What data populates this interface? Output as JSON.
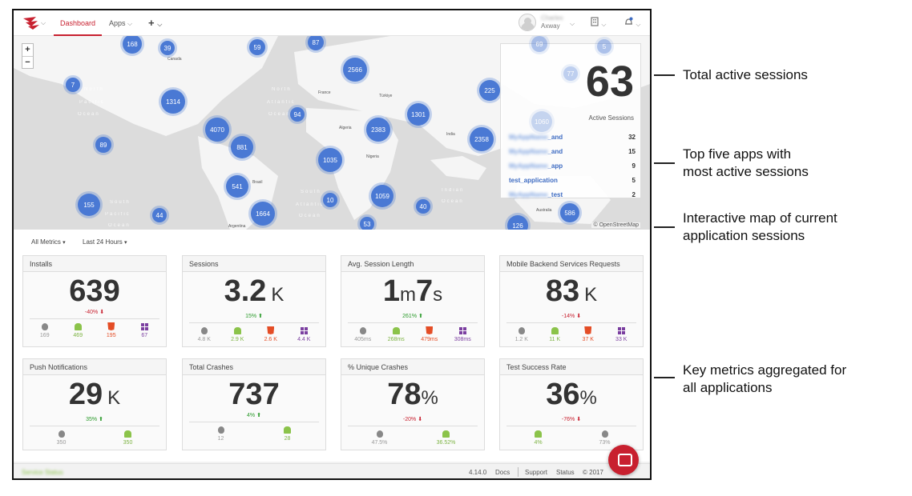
{
  "nav": {
    "dashboard": "Dashboard",
    "apps": "Apps",
    "add": "+",
    "user_name": "Charles",
    "user_org": "Axway"
  },
  "map": {
    "zoom_in": "+",
    "zoom_out": "−",
    "attribution": "© OpenStreetMap",
    "clusters": [
      "168",
      "39",
      "59",
      "87",
      "2566",
      "7",
      "1314",
      "94",
      "1301",
      "225",
      "4070",
      "2383",
      "881",
      "89",
      "2358",
      "1035",
      "541",
      "10",
      "1059",
      "40",
      "155",
      "44",
      "1664",
      "53",
      "126",
      "586",
      "69",
      "5",
      "77",
      "1060"
    ],
    "labels": [
      "North",
      "Pacific",
      "Ocean",
      "North",
      "Atlantic",
      "Ocean",
      "South",
      "Pacific",
      "Ocean",
      "South",
      "Atlantic",
      "Ocean",
      "Indian",
      "Ocean"
    ],
    "cities": [
      "Canada",
      "Brasil",
      "Argentina",
      "Nigeria",
      "Algeria",
      "Australia",
      "India",
      "France",
      "Türkiye"
    ]
  },
  "sessions": {
    "total": "63",
    "label": "Active Sessions",
    "apps": [
      {
        "prefix": "MyAppName",
        "name": "_and",
        "count": "32"
      },
      {
        "prefix": "MyAppName",
        "name": "_and",
        "count": "15"
      },
      {
        "prefix": "MyAppName",
        "name": "_app",
        "count": "9"
      },
      {
        "prefix": "",
        "name": "test_application",
        "count": "5"
      },
      {
        "prefix": "MyAppName",
        "name": "_test",
        "count": "2"
      }
    ]
  },
  "filters": {
    "metrics": "All Metrics",
    "period": "Last 24 Hours"
  },
  "cards": [
    {
      "title": "Installs",
      "value": "639",
      "unit": "",
      "delta": "-40%",
      "dir": "down",
      "plats": [
        {
          "p": "apple",
          "v": "169"
        },
        {
          "p": "android",
          "v": "469"
        },
        {
          "p": "html5",
          "v": "195"
        },
        {
          "p": "windows",
          "v": "67"
        }
      ]
    },
    {
      "title": "Sessions",
      "value": "3.2",
      "unit": "K",
      "delta": "15%",
      "dir": "up",
      "plats": [
        {
          "p": "apple",
          "v": "4.8 K"
        },
        {
          "p": "android",
          "v": "2.9 K"
        },
        {
          "p": "html5",
          "v": "2.6 K"
        },
        {
          "p": "windows",
          "v": "4.4 K"
        }
      ]
    },
    {
      "title": "Avg. Session Length",
      "value": "1",
      "unit": "m",
      "value2": "7",
      "unit2": "s",
      "delta": "261%",
      "dir": "up",
      "plats": [
        {
          "p": "apple",
          "v": "405ms"
        },
        {
          "p": "android",
          "v": "268ms"
        },
        {
          "p": "html5",
          "v": "479ms"
        },
        {
          "p": "windows",
          "v": "308ms"
        }
      ]
    },
    {
      "title": "Mobile Backend Services Requests",
      "value": "83",
      "unit": "K",
      "delta": "-14%",
      "dir": "down",
      "plats": [
        {
          "p": "apple",
          "v": "1.2 K"
        },
        {
          "p": "android",
          "v": "11 K"
        },
        {
          "p": "html5",
          "v": "37 K"
        },
        {
          "p": "windows",
          "v": "33 K"
        }
      ]
    },
    {
      "title": "Push Notifications",
      "value": "29",
      "unit": "K",
      "delta": "35%",
      "dir": "up",
      "plats": [
        {
          "p": "apple",
          "v": "350"
        },
        {
          "p": "android",
          "v": "350"
        }
      ]
    },
    {
      "title": "Total Crashes",
      "value": "737",
      "unit": "",
      "delta": "4%",
      "dir": "up",
      "plats": [
        {
          "p": "apple",
          "v": "12"
        },
        {
          "p": "android",
          "v": "28"
        }
      ]
    },
    {
      "title": "% Unique Crashes",
      "value": "78",
      "unit": "%",
      "delta": "-20%",
      "dir": "down",
      "plats": [
        {
          "p": "apple",
          "v": "47.5%"
        },
        {
          "p": "android",
          "v": "36.52%"
        }
      ]
    },
    {
      "title": "Test Success Rate",
      "value": "36",
      "unit": "%",
      "delta": "-76%",
      "dir": "down",
      "plats": [
        {
          "p": "android",
          "v": "4%"
        },
        {
          "p": "apple",
          "v": "73%"
        }
      ]
    }
  ],
  "footer": {
    "status": "Service Status",
    "version": "4.14.0",
    "docs": "Docs",
    "support": "Support",
    "status_link": "Status",
    "copyright": "© 2017"
  },
  "annotations": {
    "a1": "Total active sessions",
    "a2_l1": "Top five apps with",
    "a2_l2": "most active sessions",
    "a3_l1": "Interactive map of current",
    "a3_l2": "application sessions",
    "a4_l1": "Key metrics aggregated for",
    "a4_l2": "all applications"
  },
  "colors": {
    "accent": "#c8202f",
    "cluster": "#4a79d4",
    "up": "#2a9a2a",
    "down": "#c8202f"
  }
}
